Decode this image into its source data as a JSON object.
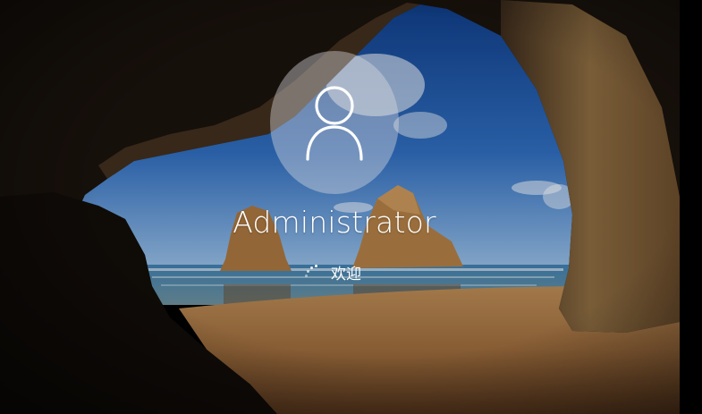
{
  "login": {
    "username": "Administrator",
    "status_text": "欢迎"
  },
  "icons": {
    "avatar": "user-silhouette-icon",
    "spinner": "loading-spinner-icon"
  },
  "colors": {
    "text": "#ffffff",
    "avatar_bg": "rgba(220,220,225,0.42)"
  }
}
